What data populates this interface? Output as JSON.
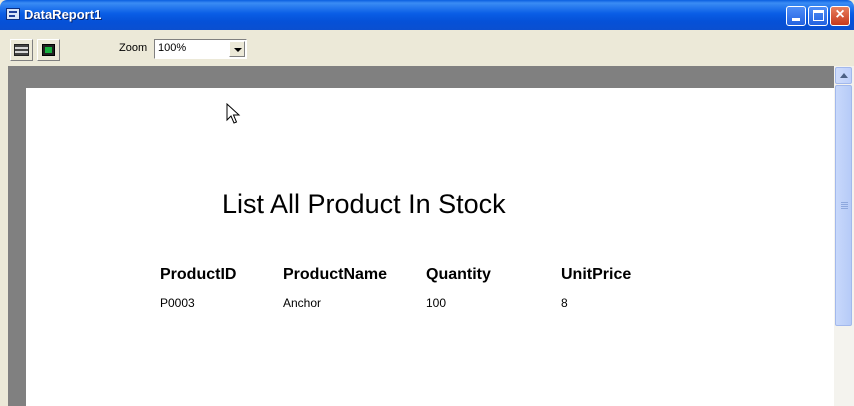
{
  "window": {
    "title": "DataReport1"
  },
  "toolbar": {
    "zoom_label": "Zoom",
    "zoom_value": "100%"
  },
  "report": {
    "title": "List All Product In Stock",
    "columns": [
      "ProductID",
      "ProductName",
      "Quantity",
      "UnitPrice"
    ],
    "rows": [
      [
        "P0003",
        "Anchor",
        "100",
        "8"
      ]
    ]
  }
}
